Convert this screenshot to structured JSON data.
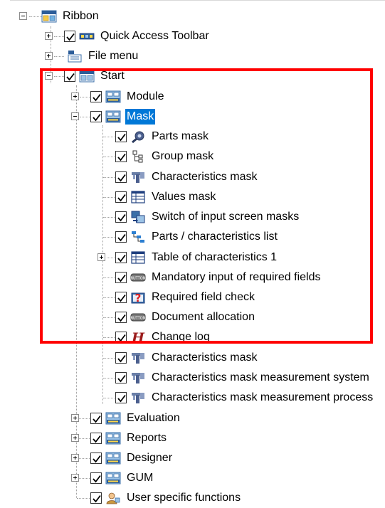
{
  "colors": {
    "selection": "#0078d7",
    "highlight_box": "#ff0000"
  },
  "tree": {
    "ribbon": {
      "label": "Ribbon",
      "icon": "file-ribbon-icon"
    },
    "quick_access": {
      "label": "Quick Access Toolbar",
      "icon": "toolbar-strip-icon"
    },
    "file_menu": {
      "label": "File menu",
      "icon": "file-menu-icon"
    },
    "start": {
      "label": "Start",
      "icon": "mask-ribbon-icon"
    },
    "module": {
      "label": "Module",
      "icon": "toolbar-icon"
    },
    "mask": {
      "label": "Mask",
      "icon": "toolbar-icon"
    },
    "mask_items": [
      {
        "label": "Parts mask",
        "icon": "parts-mask-icon"
      },
      {
        "label": "Group mask",
        "icon": "group-tree-icon"
      },
      {
        "label": "Characteristics mask",
        "icon": "caliper-icon"
      },
      {
        "label": "Values mask",
        "icon": "table-grid-icon"
      },
      {
        "label": "Switch of input screen masks",
        "icon": "switch-masks-icon"
      },
      {
        "label": "Parts / characteristics list",
        "icon": "list-tree-icon"
      },
      {
        "label": "Table of characteristics 1",
        "icon": "table-grid-icon"
      },
      {
        "label": "Mandatory input of required fields",
        "icon": "button-icon"
      },
      {
        "label": "Required field check",
        "icon": "question-check-icon"
      },
      {
        "label": "Document allocation",
        "icon": "button-icon"
      },
      {
        "label": "Change log",
        "icon": "change-log-icon"
      },
      {
        "label": "Characteristics mask",
        "icon": "caliper-icon"
      },
      {
        "label": "Characteristics mask measurement system",
        "icon": "caliper-icon"
      },
      {
        "label": "Characteristics mask measurement process",
        "icon": "caliper-icon"
      }
    ],
    "evaluation": {
      "label": "Evaluation",
      "icon": "toolbar-icon"
    },
    "reports": {
      "label": "Reports",
      "icon": "toolbar-icon"
    },
    "designer": {
      "label": "Designer",
      "icon": "toolbar-icon"
    },
    "gum": {
      "label": "GUM",
      "icon": "toolbar-icon"
    },
    "user_functions": {
      "label": "User specific functions",
      "icon": "user-functions-icon"
    }
  }
}
